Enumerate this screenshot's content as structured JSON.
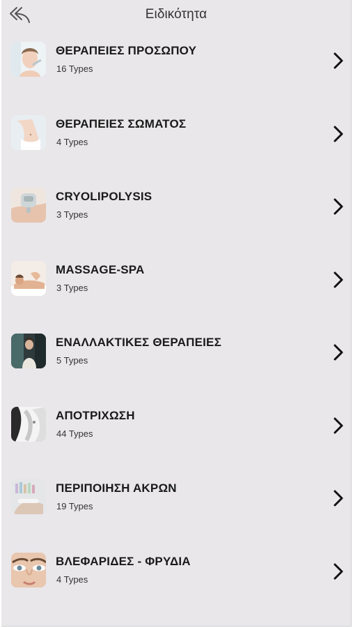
{
  "header": {
    "title": "Ειδικότητα",
    "back_icon": "back-arrow-icon"
  },
  "colors": {
    "background": "#e9e7ea",
    "title_text": "#333333",
    "item_title": "#1a1a1a",
    "chevron": "#111111"
  },
  "items": [
    {
      "title": "ΘΕΡΑΠΕΙΕΣ ΠΡΟΣΩΠΟΥ",
      "subtitle": "16 Types",
      "image": "face-treatment-thumbnail"
    },
    {
      "title": "ΘΕΡΑΠΕΙΕΣ ΣΩΜΑΤΟΣ",
      "subtitle": "4 Types",
      "image": "body-treatment-thumbnail"
    },
    {
      "title": "CRYOLIPOLYSIS",
      "subtitle": "3 Types",
      "image": "cryolipolysis-thumbnail"
    },
    {
      "title": "MASSAGE-SPA",
      "subtitle": "3 Types",
      "image": "massage-spa-thumbnail"
    },
    {
      "title": "ΕΝΑΛΛΑΚΤΙΚΕΣ ΘΕΡΑΠΕΙΕΣ",
      "subtitle": "5 Types",
      "image": "alternative-therapies-thumbnail"
    },
    {
      "title": "ΑΠΟΤΡΙΧΩΣΗ",
      "subtitle": "44 Types",
      "image": "hair-removal-thumbnail"
    },
    {
      "title": "ΠΕΡΙΠΟΙΗΣΗ ΑΚΡΩΝ",
      "subtitle": "19 Types",
      "image": "nail-care-thumbnail"
    },
    {
      "title": "ΒΛΕΦΑΡΙΔΕΣ - ΦΡΥΔΙΑ",
      "subtitle": "4 Types",
      "image": "lashes-brows-thumbnail"
    }
  ]
}
